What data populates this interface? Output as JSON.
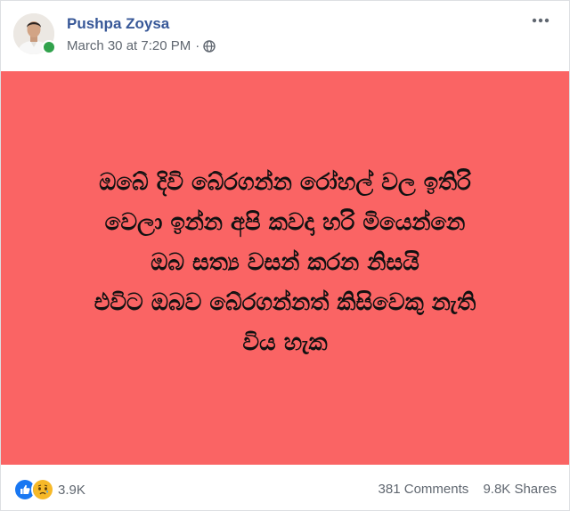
{
  "post": {
    "author": "Pushpa Zoysa",
    "timestamp": "March 30 at 7:20 PM",
    "separator": "·",
    "privacy_icon": "globe-icon",
    "more_icon": "more-options-icon",
    "content_background": "#fa6464",
    "content_lines": [
      "ඔබේ දිවි බේරගන්න රෝහල් වල ඉතිරි",
      "වෙලා ඉන්න අපි කවදා හරි මියෙන්නෙ",
      "ඔබ සත්‍ය වසන් කරන නිසයි",
      "එවිට ඔබව බේරගන්නත් කිසිවෙකු නැති",
      "විය හැක"
    ]
  },
  "engagement": {
    "reaction_icons": [
      "like-icon",
      "sad-icon"
    ],
    "reaction_count": "3.9K",
    "comments": "381 Comments",
    "shares": "9.8K Shares"
  },
  "colors": {
    "author_link": "#385898",
    "meta_text": "#606770",
    "online_indicator": "#31a24c",
    "like_blue": "#1877f2",
    "sad_yellow": "#f7b928"
  }
}
